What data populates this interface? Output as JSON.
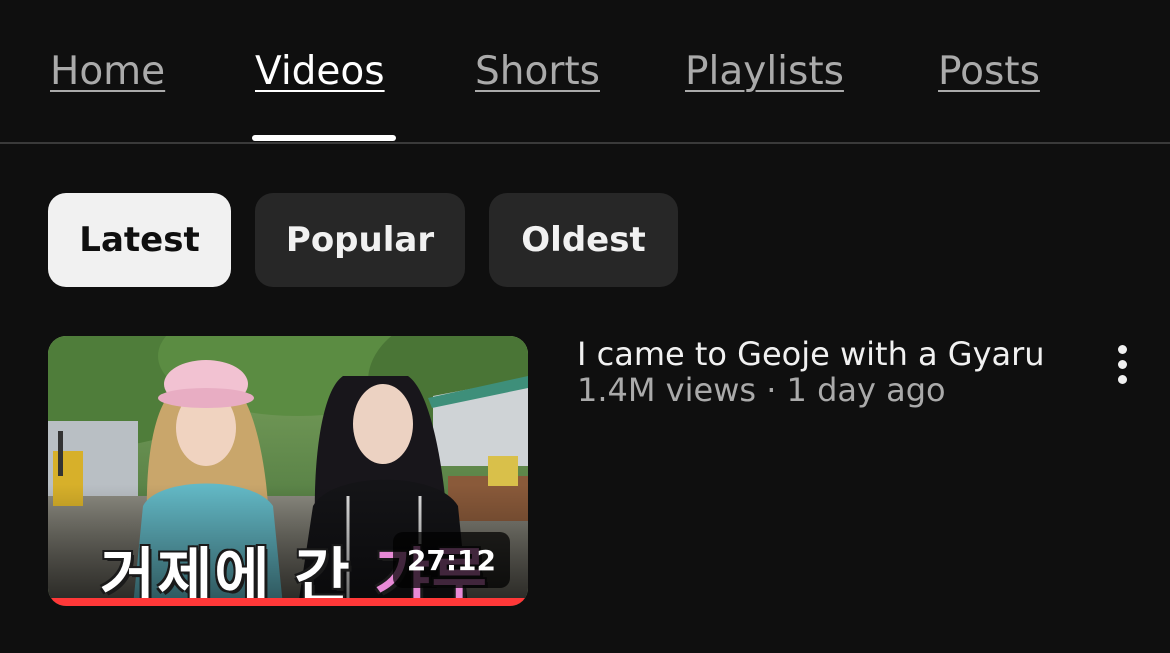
{
  "tabs": {
    "items": [
      {
        "label": "Home"
      },
      {
        "label": "Videos"
      },
      {
        "label": "Shorts"
      },
      {
        "label": "Playlists"
      },
      {
        "label": "Posts"
      }
    ],
    "active": "Videos"
  },
  "chips": {
    "items": [
      {
        "label": "Latest"
      },
      {
        "label": "Popular"
      },
      {
        "label": "Oldest"
      }
    ],
    "selected": "Latest"
  },
  "video": {
    "title": "I came to Geoje with a Gyaru",
    "meta": "1.4M views · 1 day ago",
    "duration": "27:12",
    "thumbnail_caption": {
      "main": "거제에 간 ",
      "accent": "갸루"
    },
    "watch_progress_fraction": 1.0,
    "progress_color": "#ff3838",
    "caption_accent_color": "#e88ad6",
    "more_icon": "vertical-ellipsis-icon"
  }
}
